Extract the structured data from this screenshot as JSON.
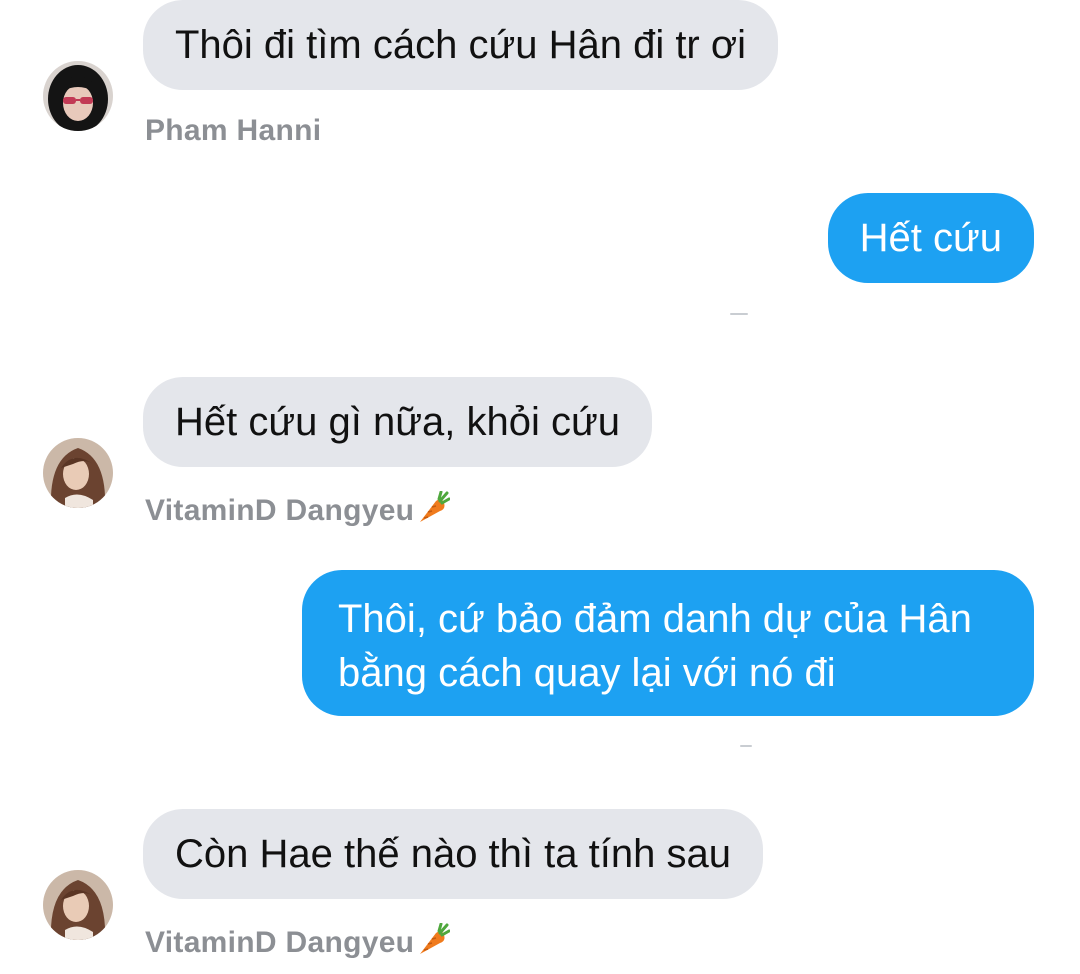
{
  "messages": [
    {
      "text": "Thôi đi tìm cách cứu Hân đi tr ơi",
      "direction": "incoming"
    },
    {
      "text": "Hết cứu",
      "direction": "outgoing"
    },
    {
      "text": "Hết cứu gì nữa, khỏi cứu",
      "direction": "incoming"
    },
    {
      "text": "Thôi, cứ bảo đảm danh dự của Hân bằng cách quay lại với nó đi",
      "direction": "outgoing"
    },
    {
      "text": "Còn Hae thế nào thì ta tính sau",
      "direction": "incoming"
    }
  ],
  "senders": [
    {
      "name": "Pham Hanni"
    },
    {
      "name": "VitaminD Dangyeu"
    },
    {
      "name": "VitaminD Dangyeu"
    }
  ],
  "colors": {
    "incoming_bubble": "#e4e6eb",
    "outgoing_bubble": "#1da1f2",
    "sender_name": "#8c8f94"
  },
  "icons": {
    "sender_emoji": "carrot-icon"
  }
}
